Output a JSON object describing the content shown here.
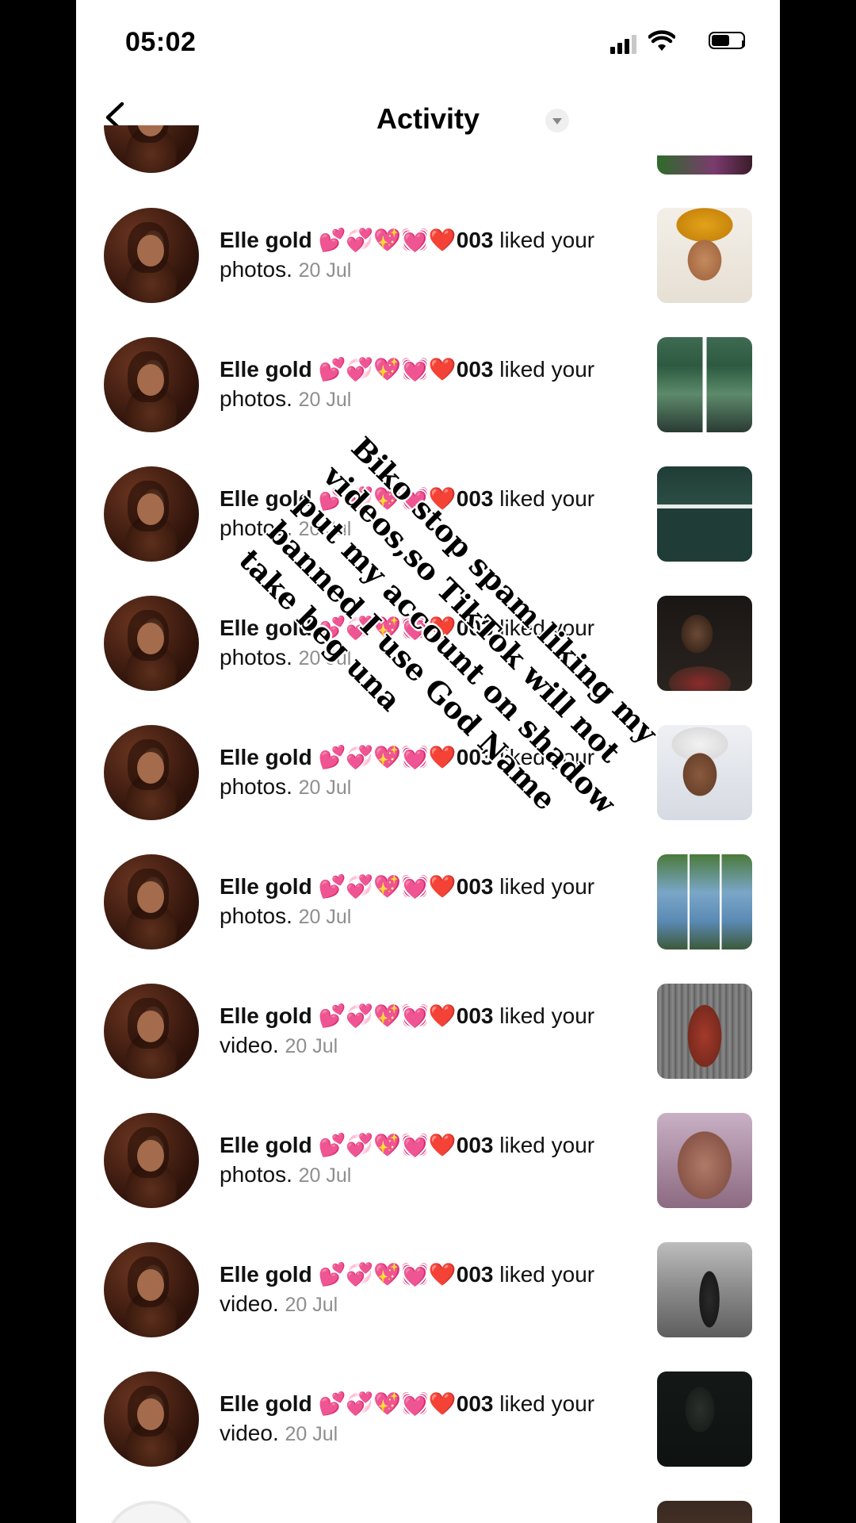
{
  "status_bar": {
    "time": "05:02"
  },
  "header": {
    "title": "Activity"
  },
  "activity": {
    "items": [
      {
        "user": "Elle gold 💕💞💖💓❤️003",
        "action": "liked your photos.",
        "date": "20 Jul"
      },
      {
        "user": "Elle gold 💕💞💖💓❤️003",
        "action": "liked your photos.",
        "date": "20 Jul"
      },
      {
        "user": "Elle gold 💕💞💖💓❤️003",
        "action": "liked your photos.",
        "date": "20 Jul"
      },
      {
        "user": "Elle gold 💕💞💖💓❤️003",
        "action": "liked your photos.",
        "date": "20 Jul"
      },
      {
        "user": "Elle gold 💕💞💖💓❤️003",
        "action": "liked your photos.",
        "date": "20 Jul"
      },
      {
        "user": "Elle gold 💕💞💖💓❤️003",
        "action": "liked your photos.",
        "date": "20 Jul"
      },
      {
        "user": "Elle gold 💕💞💖💓❤️003",
        "action": "liked your video.",
        "date": "20 Jul"
      },
      {
        "user": "Elle gold 💕💞💖💓❤️003",
        "action": "liked your photos.",
        "date": "20 Jul"
      },
      {
        "user": "Elle gold 💕💞💖💓❤️003",
        "action": "liked your video.",
        "date": "20 Jul"
      },
      {
        "user": "Elle gold 💕💞💖💓❤️003",
        "action": "liked your video.",
        "date": "20 Jul"
      }
    ]
  },
  "overlay": {
    "caption": "Biko stop spam liking my videos,so TikTok will not put my account on shadow banned I use God Name take beg una"
  },
  "icons": {
    "back": "chevron-left-icon",
    "dropdown": "chevron-down-icon",
    "signal": "cellular-signal-icon",
    "wifi": "wifi-icon",
    "battery": "battery-icon"
  },
  "colors": {
    "date_text": "#8e8e8e",
    "background": "#ffffff"
  }
}
